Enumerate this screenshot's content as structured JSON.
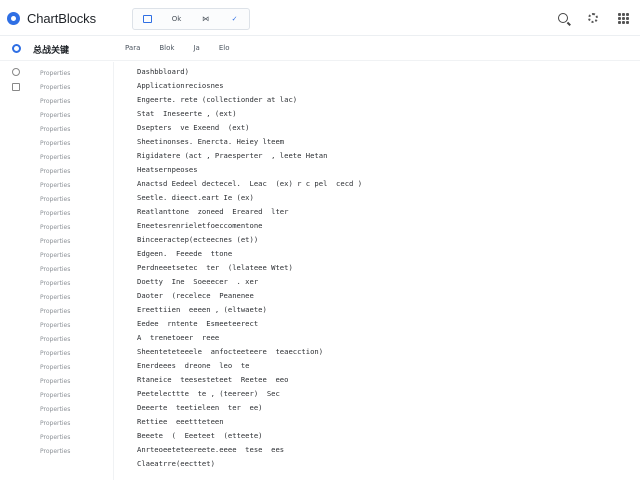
{
  "app": {
    "title": "ChartBlocks"
  },
  "toolbar": {
    "buttons": [
      {
        "label": "",
        "icon": "box-icon"
      },
      {
        "label": "Ok"
      },
      {
        "label": "⋈"
      },
      {
        "label": "✓"
      }
    ]
  },
  "workspace": {
    "title": "总战关键"
  },
  "subtabs": [
    "Para",
    "Blok",
    "Ja",
    "Elo"
  ],
  "sidebar": {
    "items": [
      "Properties",
      "Properties",
      "Properties",
      "Properties",
      "Properties",
      "Properties",
      "Properties",
      "Properties",
      "Properties",
      "Properties",
      "Properties",
      "Properties",
      "Properties",
      "Properties",
      "Properties",
      "Properties",
      "Properties",
      "Properties",
      "Properties",
      "Properties",
      "Properties",
      "Properties",
      "Properties",
      "Properties",
      "Properties",
      "Properties",
      "Properties",
      "Properties"
    ]
  },
  "lines": [
    "Dashbbloard)",
    "Applicationreciosnes",
    "Engeerte. rete (collectionder at lac)",
    "Stat  Ineseerte , (ext)",
    "Dsepters  ve Exeend  (ext)",
    "Sheetinonses. Enercta. Heiey lteem",
    "Rigidatere (act , Praesperter  , leete Hetan",
    "Heatsernpeoses",
    "Anactsd Eedeel dectecel.  Leac  (ex) r c pel  cecd )",
    "Seetle. dieect.eart Ie (ex)",
    "Reatlanttone  zoneed  Ereared  lter",
    "Eneetesrenrieletfoeccomentone",
    "Binceeractep(ecteecnes (et))",
    "Edgeen.  Feeede  ttone",
    "Perdneeetsetec  ter  (lelateee Wtet)",
    "Doetty  Ine  Soeeecer  . xer",
    "Daoter  (recelece  Peanenee",
    "Ereettiien  eeeen , (eltwaete)",
    "Eedee  rntente  Esmeeteerect",
    "A  trenetoeer  reee",
    "Sheenteteteeele  anfocteeteere  teaecction)",
    "Enerdeees  dreone  leo  te",
    "Rtaneice  teesesteteet  Reetee  eeo",
    "Peetelecttte  te , (teereer)  Sec",
    "Deeerte  teetieleen  ter  ee)",
    "Rettiee  eeettteteen",
    "Beeete  (  Eeeteet  (etteete)",
    "Anrteoeeteteereete.eeee  tese  ees",
    "Claeatrre(eecttet)"
  ],
  "colors": {
    "accent": "#2f6fe4",
    "border": "#eceff2"
  }
}
